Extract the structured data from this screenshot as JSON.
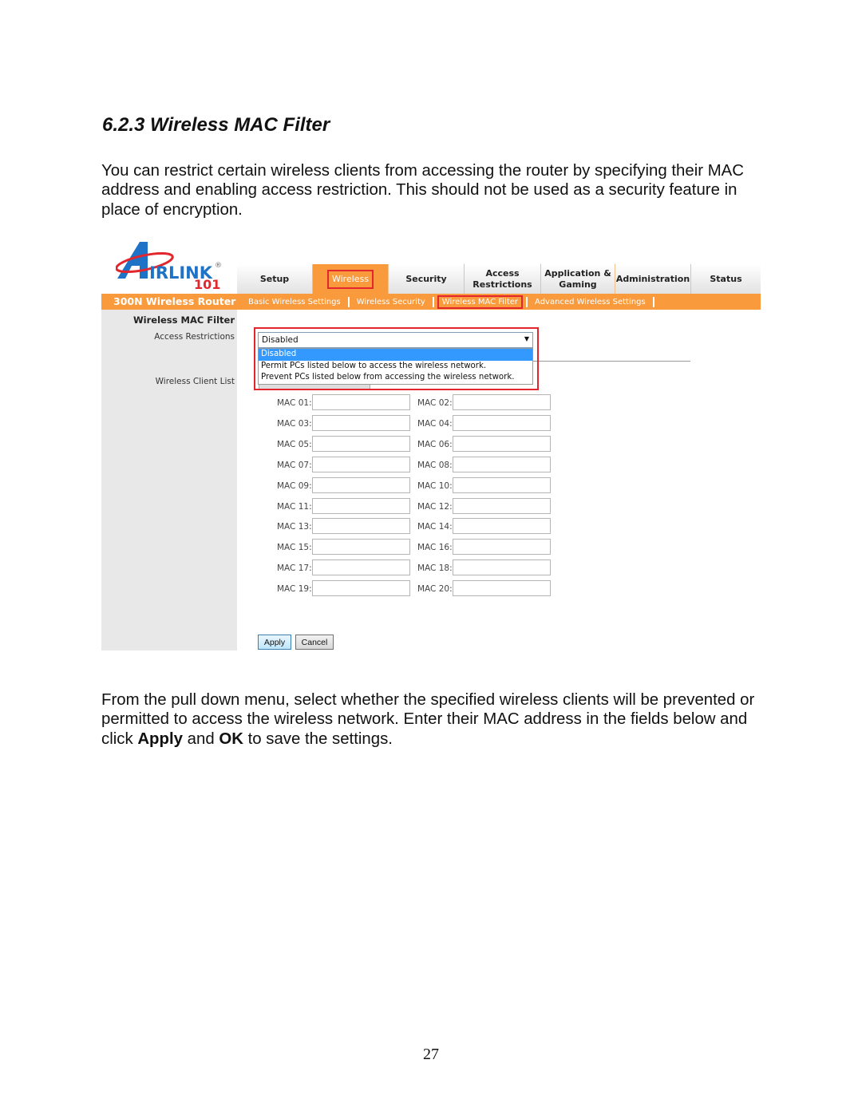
{
  "document": {
    "heading": "6.2.3 Wireless MAC Filter",
    "intro": "You can restrict certain wireless clients from accessing the router by specifying their MAC address and enabling access restriction.  This should not be used as a security feature in place of encryption.",
    "instructions": {
      "part1": "From the pull down menu, select whether the specified wireless clients will be prevented or permitted to access the wireless network. Enter their MAC address in the fields below and click ",
      "bold1": "Apply",
      "part2": " and ",
      "bold2": "OK",
      "part3": " to save the settings."
    },
    "page_number": "27"
  },
  "router": {
    "logo": {
      "text": "IRLINK",
      "number": "101",
      "mark": "®"
    },
    "product_name": "300N Wireless Router",
    "nav_tabs": [
      {
        "label": "Setup"
      },
      {
        "label": "Wireless",
        "active": true
      },
      {
        "label": "Security"
      },
      {
        "label": "Access Restrictions"
      },
      {
        "label": "Application & Gaming"
      },
      {
        "label": "Administration"
      },
      {
        "label": "Status"
      }
    ],
    "sub_tabs": [
      {
        "label": "Basic Wireless Settings"
      },
      {
        "label": "Wireless Security"
      },
      {
        "label": "Wireless MAC Filter",
        "active": true
      },
      {
        "label": "Advanced Wireless Settings"
      }
    ],
    "section_title": "Wireless MAC Filter",
    "access_restrictions_label": "Access Restrictions",
    "wireless_client_list_label": "Wireless Client List",
    "access_restrictions": {
      "value": "Disabled",
      "options": [
        "Disabled",
        "Permit PCs listed below to access the wireless network.",
        "Prevent PCs listed below  from accessing the wireless network."
      ],
      "highlighted_option": "Disabled"
    },
    "mac_fields": [
      {
        "label": "MAC 01:",
        "value": ""
      },
      {
        "label": "MAC 02:",
        "value": ""
      },
      {
        "label": "MAC 03:",
        "value": ""
      },
      {
        "label": "MAC 04:",
        "value": ""
      },
      {
        "label": "MAC 05:",
        "value": ""
      },
      {
        "label": "MAC 06:",
        "value": ""
      },
      {
        "label": "MAC 07:",
        "value": ""
      },
      {
        "label": "MAC 08:",
        "value": ""
      },
      {
        "label": "MAC 09:",
        "value": ""
      },
      {
        "label": "MAC 10:",
        "value": ""
      },
      {
        "label": "MAC 11:",
        "value": ""
      },
      {
        "label": "MAC 12:",
        "value": ""
      },
      {
        "label": "MAC 13:",
        "value": ""
      },
      {
        "label": "MAC 14:",
        "value": ""
      },
      {
        "label": "MAC 15:",
        "value": ""
      },
      {
        "label": "MAC 16:",
        "value": ""
      },
      {
        "label": "MAC 17:",
        "value": ""
      },
      {
        "label": "MAC 18:",
        "value": ""
      },
      {
        "label": "MAC 19:",
        "value": ""
      },
      {
        "label": "MAC 20:",
        "value": ""
      }
    ],
    "buttons": {
      "apply": "Apply",
      "cancel": "Cancel"
    },
    "colors": {
      "brand_orange": "#f99a3d",
      "highlight_red": "#e3262e",
      "logo_blue": "#1f73c7",
      "selection_blue": "#3399ff"
    }
  }
}
